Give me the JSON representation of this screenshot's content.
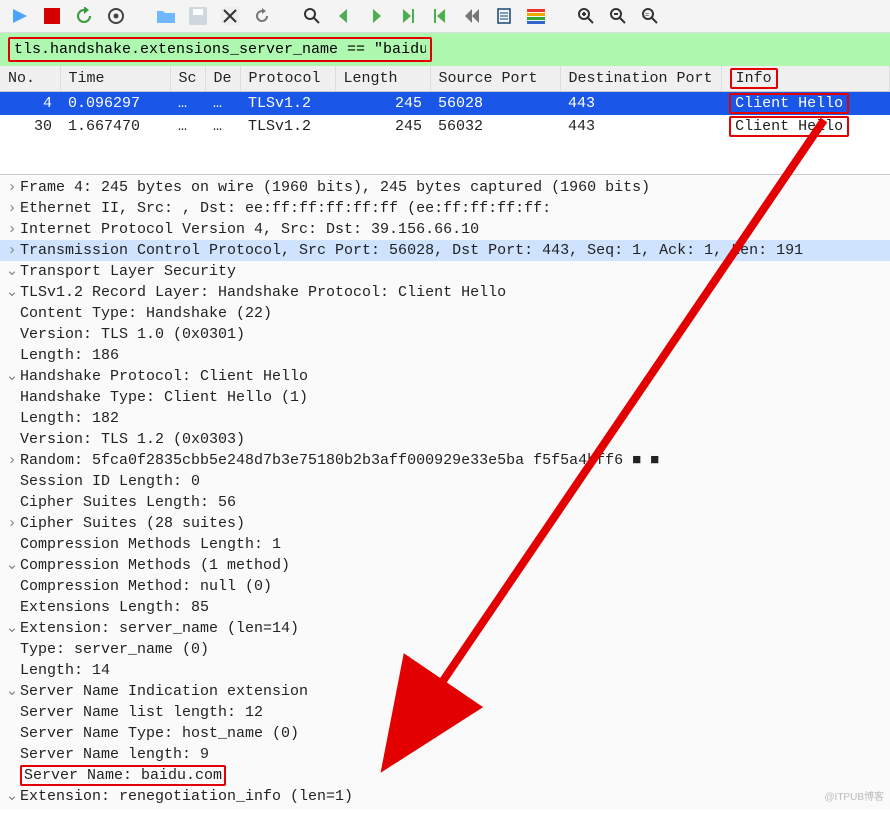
{
  "toolbar_icons": [
    "start-capture-icon",
    "stop-capture-icon",
    "restart-capture-icon",
    "options-icon",
    "open-file-icon",
    "save-file-icon",
    "close-file-icon",
    "reload-icon",
    "find-icon",
    "back-icon",
    "forward-icon",
    "jump-icon",
    "go-first-icon",
    "go-last-icon",
    "auto-scroll-icon",
    "colorize-icon",
    "zoom-in-icon",
    "zoom-out-icon",
    "zoom-reset-icon"
  ],
  "filter": {
    "text": "tls.handshake.extensions_server_name == \"baidu.com\""
  },
  "columns": {
    "no": "No.",
    "time": "Time",
    "sc": "Sc",
    "de": "De",
    "proto": "Protocol",
    "len": "Length",
    "sport": "Source Port",
    "dport": "Destination Port",
    "info": "Info"
  },
  "packets": [
    {
      "no": "4",
      "time": "0.096297",
      "sc": "…",
      "de": "…",
      "proto": "TLSv1.2",
      "len": "245",
      "sport": "56028",
      "dport": "443",
      "info": "Client Hello",
      "selected": true
    },
    {
      "no": "30",
      "time": "1.667470",
      "sc": "…",
      "de": "…",
      "proto": "TLSv1.2",
      "len": "245",
      "sport": "56032",
      "dport": "443",
      "info": "Client Hello",
      "selected": false
    }
  ],
  "detail": {
    "frame": "Frame 4: 245 bytes on wire (1960 bits), 245 bytes captured (1960 bits)",
    "eth": "Ethernet II, Src:                                    , Dst: ee:ff:ff:ff:ff:ff (ee:ff:ff:ff:ff:",
    "ip": "Internet Protocol Version 4, Src:               Dst: 39.156.66.10",
    "tcp": "Transmission Control Protocol, Src Port: 56028, Dst Port: 443, Seq: 1, Ack: 1, Len: 191",
    "tls": "Transport Layer Security",
    "record": "TLSv1.2 Record Layer: Handshake Protocol: Client Hello",
    "ct": "Content Type: Handshake (22)",
    "ver1": "Version: TLS 1.0 (0x0301)",
    "len1": "Length: 186",
    "hs": "Handshake Protocol: Client Hello",
    "hstype": "Handshake Type: Client Hello (1)",
    "len2": "Length: 182",
    "ver2": "Version: TLS 1.2 (0x0303)",
    "rand": "Random: 5fca0f2835cbb5e248d7b3e75180b2b3aff000929e33e5ba f5f5a4bff6 ■ ■",
    "sidlen": "Session ID Length: 0",
    "cslen": "Cipher Suites Length: 56",
    "cs": "Cipher Suites (28 suites)",
    "cmlen": "Compression Methods Length: 1",
    "cm": "Compression Methods (1 method)",
    "cmnull": "Compression Method: null (0)",
    "extlen": "Extensions Length: 85",
    "extsn": "Extension: server_name (len=14)",
    "sntype": "Type: server_name (0)",
    "snlen": "Length: 14",
    "sni": "Server Name Indication extension",
    "snll": "Server Name list length: 12",
    "sntype2": "Server Name Type: host_name (0)",
    "snlen2": "Server Name length: 9",
    "sn": "Server Name: baidu.com",
    "extrn": "Extension: renegotiation_info (len=1)"
  },
  "watermark": "@ITPUB博客"
}
